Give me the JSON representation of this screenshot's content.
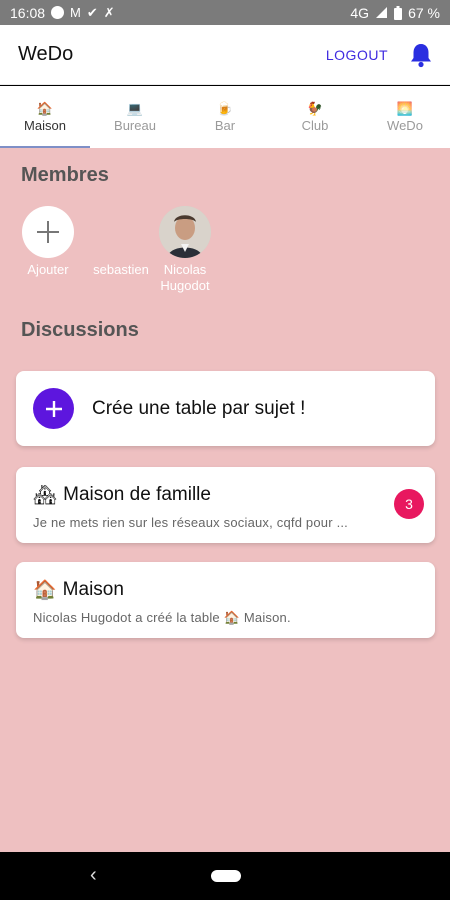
{
  "status_bar": {
    "time": "16:08",
    "network": "4G",
    "battery": "67 %",
    "icons": [
      "circle-notification-icon",
      "gmail-icon",
      "check-icon",
      "missed-call-icon",
      "signal-icon",
      "battery-icon"
    ]
  },
  "app_bar": {
    "title": "WeDo",
    "logout_label": "LOGOUT",
    "bell_icon": "bell-icon",
    "accent_color": "#3f2be0"
  },
  "tabs": [
    {
      "emoji": "🏠",
      "label": "Maison",
      "active": true
    },
    {
      "emoji": "💻",
      "label": "Bureau",
      "active": false
    },
    {
      "emoji": "🍺",
      "label": "Bar",
      "active": false
    },
    {
      "emoji": "🐓",
      "label": "Club",
      "active": false
    },
    {
      "emoji": "🌅",
      "label": "WeDo",
      "active": false
    }
  ],
  "members": {
    "title": "Membres",
    "add_label": "Ajouter",
    "people": [
      {
        "name": "sebastien"
      },
      {
        "name": "Nicolas\nHugodot"
      }
    ]
  },
  "discussions": {
    "title": "Discussions",
    "create_label": "Crée une table par sujet !",
    "items": [
      {
        "emoji": "🏘",
        "title": "Maison de famille",
        "preview": "Je ne mets rien sur les réseaux sociaux, cqfd pour ...",
        "badge": "3"
      },
      {
        "emoji": "🏠",
        "title": "Maison",
        "preview": "Nicolas Hugodot a créé la table 🏠 Maison.",
        "badge": null
      }
    ]
  },
  "colors": {
    "content_background": "#eec0c1",
    "fab": "#5d16de",
    "badge": "#e8185f"
  }
}
